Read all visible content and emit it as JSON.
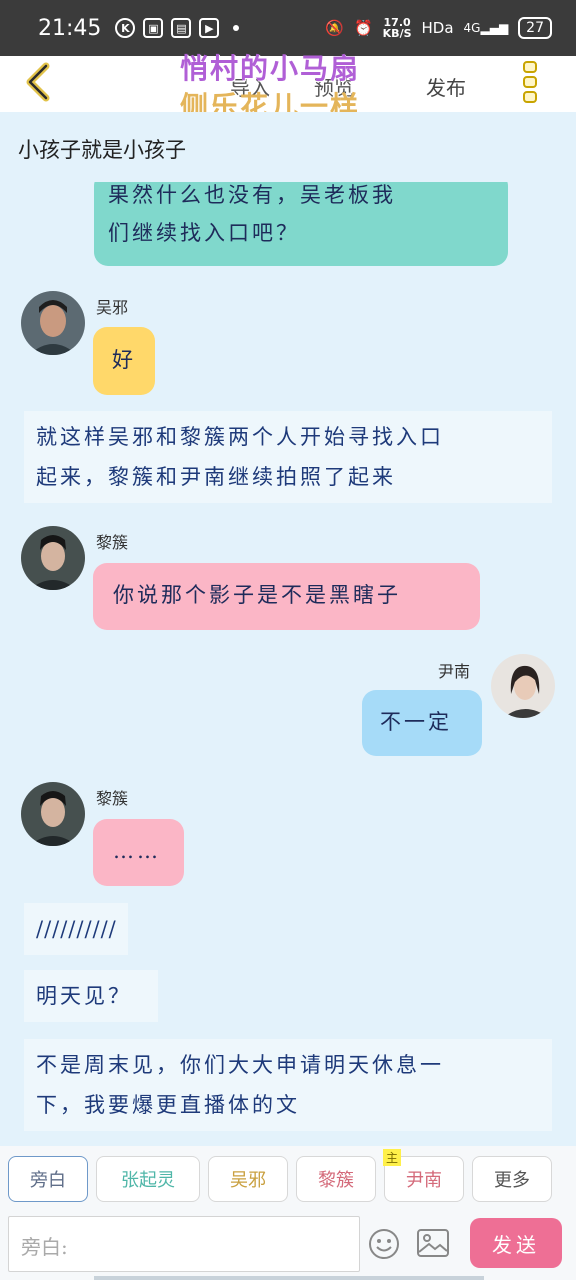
{
  "status_bar": {
    "time": "21:45",
    "speed_value": "17.0",
    "speed_unit": "KB/S",
    "hd": "HDa",
    "signal": "4G",
    "battery": "27"
  },
  "header": {
    "tabs": [
      "导入",
      "预览"
    ],
    "publish": "发布",
    "logo_line1": "悄村的小马扇",
    "logo_line2": "侧乐花儿一样"
  },
  "chat_title": "小孩子就是小孩子",
  "messages": [
    {
      "type": "partial",
      "text_line1": "果然什么也没有，吴老板我",
      "text_line2": "们继续找入口吧？"
    },
    {
      "type": "left",
      "name": "吴邪",
      "text": "好"
    },
    {
      "type": "narration",
      "text_line1": "就这样吴邪和黎簇两个人开始寻找入口",
      "text_line2": "起来，黎簇和尹南继续拍照了起来"
    },
    {
      "type": "left",
      "name": "黎簇",
      "text": "你说那个影子是不是黑瞎子"
    },
    {
      "type": "right",
      "name": "尹南",
      "text": "不一定"
    },
    {
      "type": "left",
      "name": "黎簇",
      "text": "……"
    },
    {
      "type": "narration",
      "text": "//////////"
    },
    {
      "type": "narration",
      "text": "明天见？"
    },
    {
      "type": "narration",
      "text_line1": "不是周末见，你们大大申请明天休息一",
      "text_line2": "下，我要爆更直播体的文"
    }
  ],
  "chips": [
    "旁白",
    "张起灵",
    "吴邪",
    "黎簇",
    "尹南",
    "更多"
  ],
  "chip_badge": "主",
  "input": {
    "placeholder": "旁白:"
  },
  "send_label": "发送",
  "colors": {
    "teal_bubble": "#80d8cc",
    "yellow_bubble": "#ffd86a",
    "pink_bubble": "#fbb6c6",
    "blue_bubble": "#a6dbf8",
    "send": "#ee6f95"
  }
}
